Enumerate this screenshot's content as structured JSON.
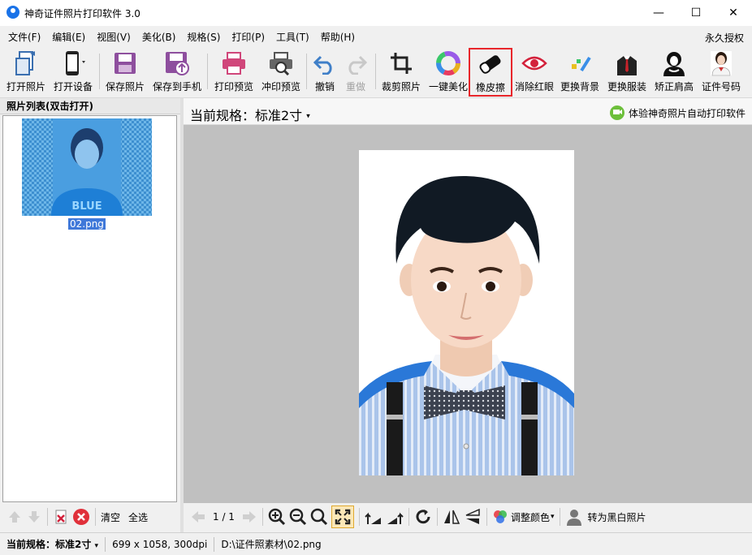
{
  "window": {
    "title": "神奇证件照片打印软件 3.0",
    "minimize": "—",
    "maximize": "☐",
    "close": "✕"
  },
  "menu": {
    "items": [
      "文件(F)",
      "编辑(E)",
      "视图(V)",
      "美化(B)",
      "规格(S)",
      "打印(P)",
      "工具(T)",
      "帮助(H)"
    ],
    "license": "永久授权"
  },
  "toolbar": {
    "buttons": [
      {
        "label": "打开照片",
        "icon": "open-photo-icon"
      },
      {
        "label": "打开设备",
        "icon": "phone-device-icon"
      },
      {
        "label": "保存照片",
        "icon": "save-icon"
      },
      {
        "label": "保存到手机",
        "icon": "save-to-phone-icon"
      },
      {
        "label": "打印预览",
        "icon": "printer-icon"
      },
      {
        "label": "冲印预览",
        "icon": "print-search-icon"
      },
      {
        "label": "撤销",
        "icon": "undo-icon"
      },
      {
        "label": "重做",
        "icon": "redo-icon"
      },
      {
        "label": "裁剪照片",
        "icon": "crop-icon"
      },
      {
        "label": "一键美化",
        "icon": "color-wheel-icon"
      },
      {
        "label": "橡皮擦",
        "icon": "eraser-icon"
      },
      {
        "label": "消除红眼",
        "icon": "red-eye-icon"
      },
      {
        "label": "更换背景",
        "icon": "change-background-icon"
      },
      {
        "label": "更换服装",
        "icon": "suit-icon"
      },
      {
        "label": "矫正肩高",
        "icon": "shoulder-icon"
      },
      {
        "label": "证件号码",
        "icon": "id-portrait-icon"
      }
    ]
  },
  "left_panel": {
    "header": "照片列表(双击打开)",
    "thumbnail": {
      "filename": "02.png",
      "shirt_text": "BLUE"
    },
    "footer": {
      "clear": "清空",
      "select_all": "全选"
    }
  },
  "spec_bar": {
    "label": "当前规格：标准2寸",
    "promo": "体验神奇照片自动打印软件"
  },
  "bottom_toolbar": {
    "page": "1 / 1",
    "adjust_color": "调整颜色",
    "to_bw": "转为黑白照片"
  },
  "status": {
    "spec": "当前规格：标准2寸",
    "dims": "699 x 1058, 300dpi",
    "path": "D:\\证件照素材\\02.png"
  },
  "colors": {
    "accent": "#e8262b",
    "thumb_bg": "#4c9fdb",
    "canvas": "#c0c0c0"
  }
}
